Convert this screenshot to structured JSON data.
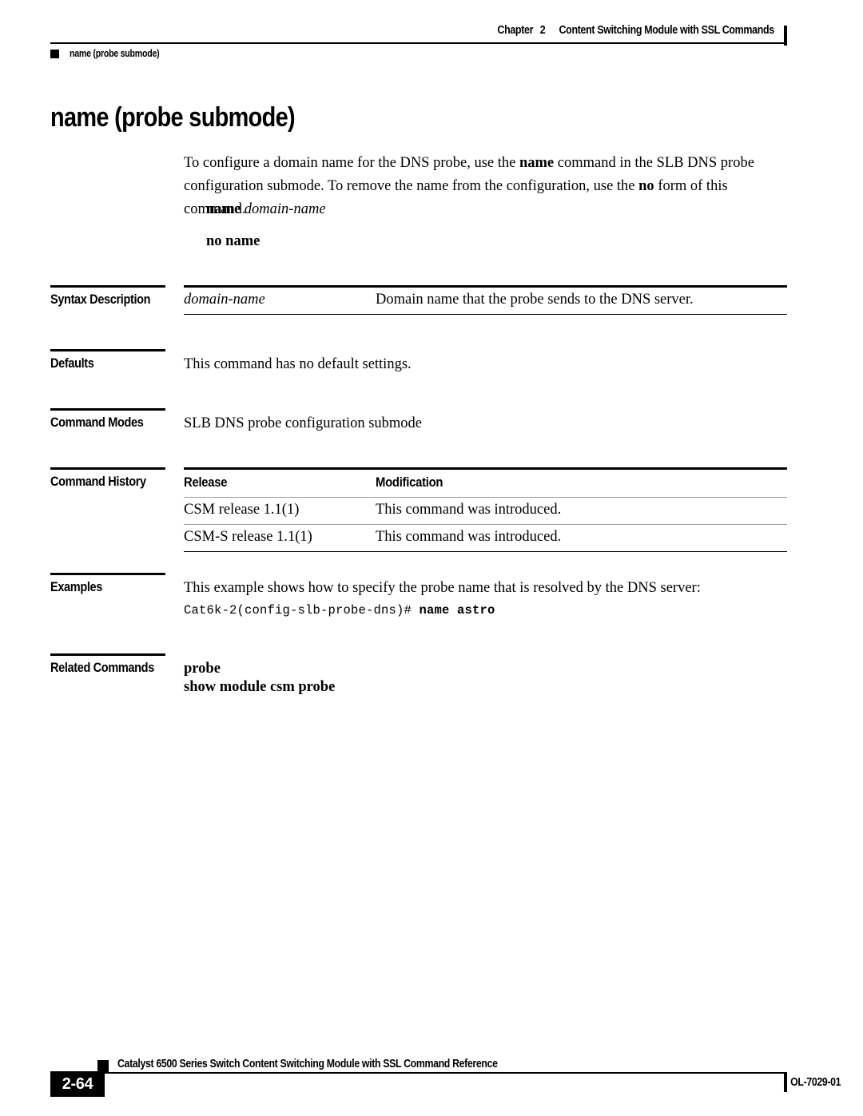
{
  "header": {
    "chapter_label": "Chapter",
    "chapter_number": "2",
    "chapter_title": "Content Switching Module with SSL Commands",
    "running_command": "name (probe submode)"
  },
  "title": "name (probe submode)",
  "intro": {
    "part1": "To configure a domain name for the DNS probe, use the ",
    "bold1": "name",
    "part2": " command in the SLB DNS probe configuration submode. To remove the name from the configuration, use the ",
    "bold2": "no",
    "part3": " form of this command."
  },
  "syntax_lines": {
    "command_bold": "name",
    "command_arg": "domain-name",
    "no_form": "no name"
  },
  "sections": {
    "syntax_description": {
      "label": "Syntax Description",
      "rows": [
        {
          "term": "domain-name",
          "description": "Domain name that the probe sends to the DNS server."
        }
      ]
    },
    "defaults": {
      "label": "Defaults",
      "text": "This command has no default settings."
    },
    "command_modes": {
      "label": "Command Modes",
      "text": "SLB DNS probe configuration submode"
    },
    "command_history": {
      "label": "Command History",
      "headers": [
        "Release",
        "Modification"
      ],
      "rows": [
        {
          "release": "CSM release 1.1(1)",
          "modification": "This command was introduced."
        },
        {
          "release": "CSM-S release 1.1(1)",
          "modification": "This command was introduced."
        }
      ]
    },
    "examples": {
      "label": "Examples",
      "text": "This example shows how to specify the probe name that is resolved by the DNS server:",
      "cli_prompt": "Cat6k-2(config-slb-probe-dns)# ",
      "cli_command": "name astro"
    },
    "related_commands": {
      "label": "Related Commands",
      "items": [
        "probe",
        "show module csm probe"
      ]
    }
  },
  "footer": {
    "page_number": "2-64",
    "doc_title": "Catalyst 6500 Series Switch Content Switching Module with SSL Command Reference",
    "doc_id": "OL-7029-01"
  }
}
